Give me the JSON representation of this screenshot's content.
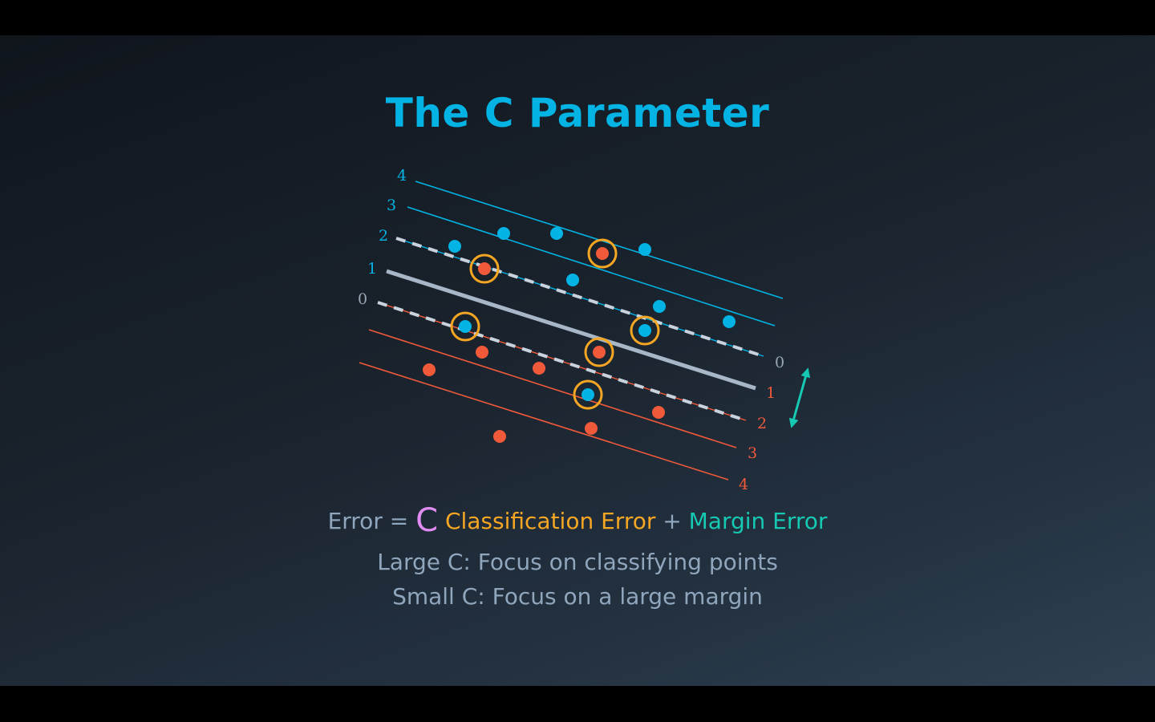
{
  "title": "The C Parameter",
  "diagram": {
    "blue_line_labels": [
      "4",
      "3",
      "2",
      "1",
      "0"
    ],
    "red_line_labels": [
      "0",
      "1",
      "2",
      "3",
      "4"
    ],
    "colors": {
      "blue": "#02b3e4",
      "red": "#f05a3a",
      "boundary": "#a8b7c8",
      "misclassified_ring": "#f5a623",
      "margin_arrow": "#16c9b2",
      "gray_label": "#9aa8b6"
    }
  },
  "equation": {
    "prefix": "Error = ",
    "c_symbol": "C",
    "classification_error": "Classification Error",
    "plus": " + ",
    "margin_error": "Margin Error"
  },
  "descriptions": {
    "large_c": "Large C: Focus on classifying points",
    "small_c": "Small C: Focus on a large margin"
  }
}
